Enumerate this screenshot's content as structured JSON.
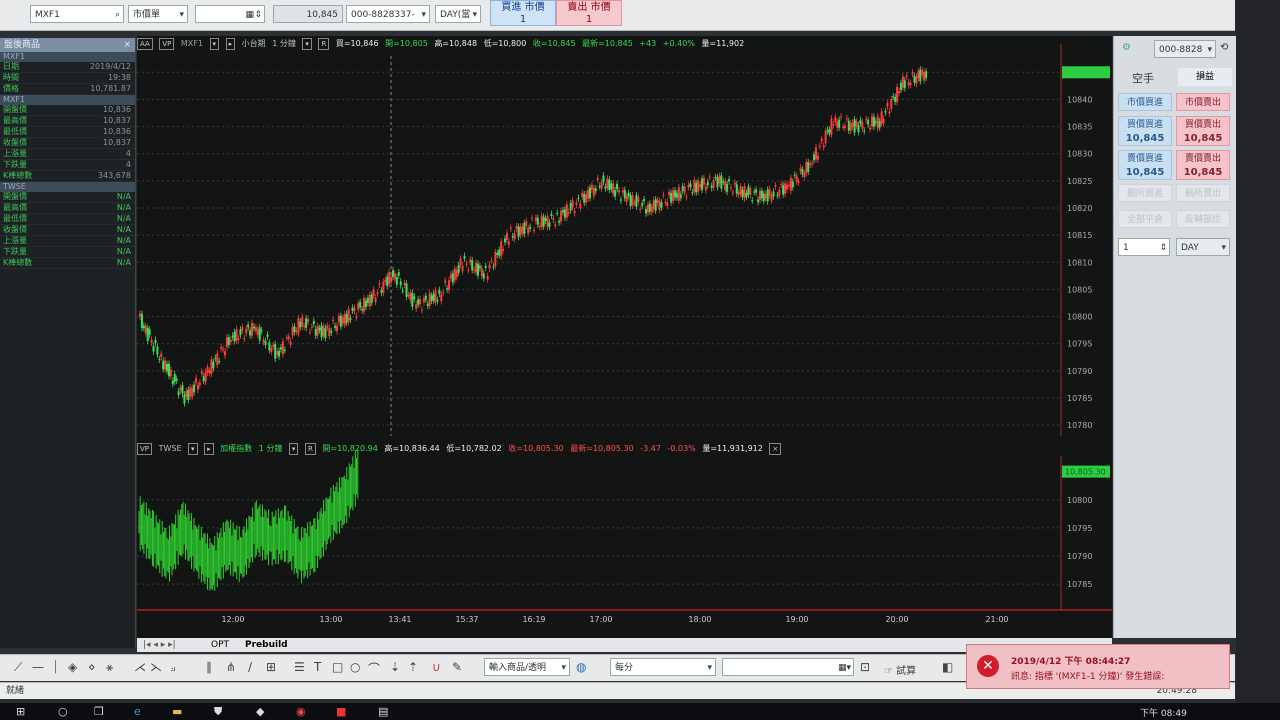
{
  "toolbar": {
    "symbol": "MXF1",
    "order_type": "市價單",
    "price": "10,845",
    "account": "000-8828337-",
    "session": "DAY(當",
    "buy_label": "買進 市價",
    "buy_qty": "1",
    "sell_label": "賣出 市價",
    "sell_qty": "1"
  },
  "left_panel": {
    "title": "盤後商品",
    "close": "×",
    "section1": "MXF1",
    "rows1": [
      {
        "label": "日期",
        "value": "2019/4/12"
      },
      {
        "label": "時間",
        "value": "19:38"
      },
      {
        "label": "價格",
        "value": "10,781.87"
      }
    ],
    "section2": "MXF1",
    "rows2": [
      {
        "label": "開盤價",
        "value": "10,836"
      },
      {
        "label": "最高價",
        "value": "10,837"
      },
      {
        "label": "最低價",
        "value": "10,836"
      },
      {
        "label": "收盤價",
        "value": "10,837"
      },
      {
        "label": "上漲量",
        "value": "4"
      },
      {
        "label": "下跌量",
        "value": "4"
      },
      {
        "label": "K棒總數",
        "value": "343,678"
      }
    ],
    "section3": "TWSE",
    "rows3": [
      {
        "label": "開盤價",
        "value": "N/A"
      },
      {
        "label": "最高價",
        "value": "N/A"
      },
      {
        "label": "最低價",
        "value": "N/A"
      },
      {
        "label": "收盤價",
        "value": "N/A"
      },
      {
        "label": "上漲量",
        "value": "N/A"
      },
      {
        "label": "下跌量",
        "value": "N/A"
      },
      {
        "label": "K棒總數",
        "value": "N/A"
      }
    ]
  },
  "chart_top": {
    "tags": [
      "AA",
      "VP"
    ],
    "symbol": "MXF1",
    "name": "小台期",
    "interval": "1 分鐘",
    "r_tag": "R",
    "buy": "買=10,846",
    "open": "開=10,805",
    "high": "高=10,848",
    "low": "低=10,800",
    "close": "收=10,845",
    "last": "最新=10,845",
    "change": "+43",
    "pct": "+0.40%",
    "volume": "量=11,902"
  },
  "chart_bottom": {
    "tag": "VP",
    "symbol": "TWSE",
    "name": "加權指數",
    "interval": "1 分鐘",
    "r_tag": "R",
    "open": "開=10,820.94",
    "high": "高=10,836.44",
    "low": "低=10,782.02",
    "close": "收=10,805.30",
    "last": "最新=10,805.30",
    "change": "-3.47",
    "pct": "-0.03%",
    "volume": "量=11,931,912",
    "last_badge": "10,805.30"
  },
  "chart_data": [
    {
      "type": "candlestick",
      "title": "小台期 1 分鐘",
      "x": [
        "12:00",
        "13:00",
        "13:41",
        "15:37",
        "16:19",
        "17:00",
        "18:00",
        "19:00",
        "20:00",
        "21:00"
      ],
      "y_ticks": [
        10780,
        10785,
        10790,
        10795,
        10800,
        10805,
        10810,
        10815,
        10820,
        10825,
        10830,
        10835,
        10840,
        10845
      ],
      "ylim": [
        10778,
        10848
      ],
      "series": [
        {
          "name": "MXF1",
          "values": [
            10800,
            10792,
            10785,
            10790,
            10796,
            10798,
            10793,
            10799,
            10797,
            10800,
            10803,
            10808,
            10802,
            10804,
            10810,
            10808,
            10815,
            10817,
            10818,
            10821,
            10825,
            10822,
            10820,
            10822,
            10824,
            10825,
            10823,
            10822,
            10824,
            10828,
            10836,
            10835,
            10836,
            10843,
            10845
          ]
        }
      ]
    },
    {
      "type": "bar",
      "title": "加權指數 1 分鐘",
      "y_ticks": [
        10785,
        10790,
        10795,
        10800
      ],
      "ylim": [
        10782,
        10806
      ],
      "series": [
        {
          "name": "TWSE",
          "values": [
            10796,
            10793,
            10790,
            10795,
            10791,
            10788,
            10792,
            10790,
            10795,
            10793,
            10794,
            10790,
            10792,
            10797,
            10800,
            10805
          ]
        }
      ]
    }
  ],
  "right_panel": {
    "account": "000-8828",
    "position": "空手",
    "pnl": "損益",
    "market_buy": "市價買進",
    "market_sell": "市價賣出",
    "buy_bid_label": "買價買進",
    "buy_bid_price": "10,845",
    "sell_bid_label": "買價賣出",
    "sell_bid_price": "10,845",
    "buy_ask_label": "賣價買進",
    "buy_ask_price": "10,845",
    "sell_ask_label": "賣價賣出",
    "sell_ask_price": "10,845",
    "cancel_buy": "刪所買進",
    "cancel_sell": "刪所賣出",
    "cancel_all": "全部平倉",
    "reverse": "反轉部位",
    "qty": "1",
    "session": "DAY"
  },
  "tabs": {
    "opt": "OPT",
    "prebuild": "Prebuild"
  },
  "drawbar": {
    "product_input": "輸入商品/透明",
    "period": "每分",
    "trade_label": "試算"
  },
  "status": {
    "left": "就緒",
    "time": "20:49:28"
  },
  "alert": {
    "datetime": "2019/4/12 下午 08:44:27",
    "message": "訊息: 指標 '(MXF1-1 分鐘)' 發生錯誤:"
  },
  "taskbar": {
    "time": "下午 08:49"
  },
  "colors": {
    "up": "#ff3b3b",
    "down": "#3de05a",
    "bg": "#131514"
  }
}
